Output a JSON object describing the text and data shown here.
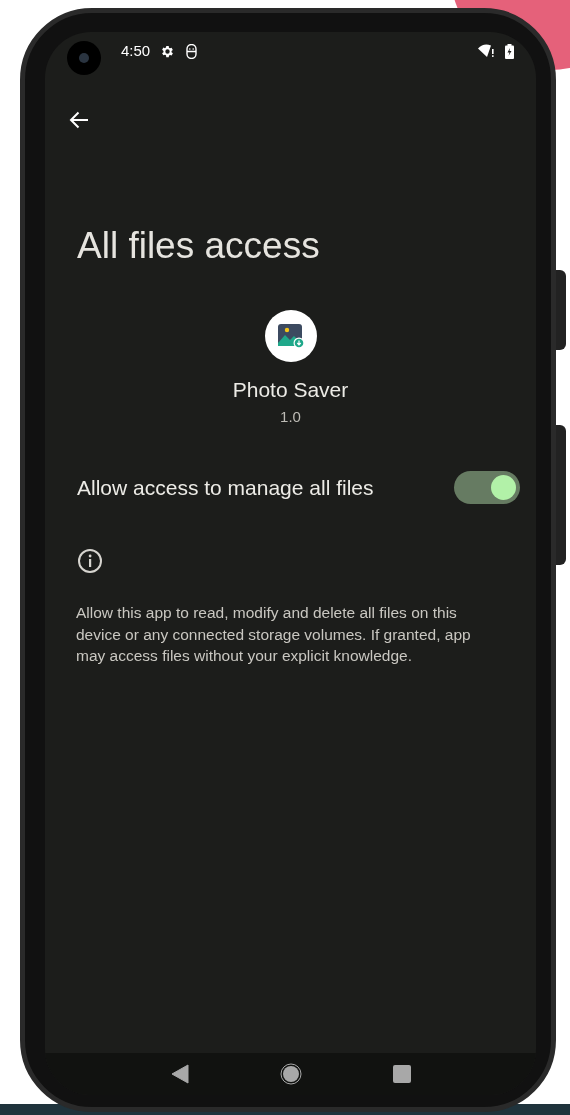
{
  "status_bar": {
    "time": "4:50"
  },
  "title": "All files access",
  "app": {
    "name": "Photo Saver",
    "version": "1.0"
  },
  "permission": {
    "label": "Allow access to manage all files",
    "on": true
  },
  "description": "Allow this app to read, modify and delete all files on this device or any connected storage volumes. If granted, app may access files without your explicit knowledge."
}
